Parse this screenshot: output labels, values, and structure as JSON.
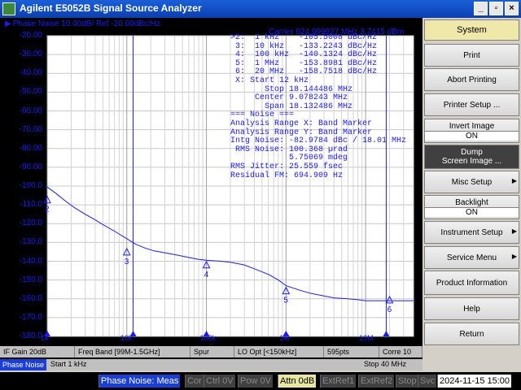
{
  "window": {
    "title": "Agilent E5052B Signal Source Analyzer",
    "btn_min": "_",
    "btn_max": "▫",
    "btn_close": "×"
  },
  "trace": {
    "title": "Phase Noise 10.00dB/ Ref -20.00dBc/Hz",
    "carrier": "Carrier 624.999927 MHz   3.7415 dBm"
  },
  "chart_data": {
    "type": "line",
    "xscale": "log",
    "xlim": [
      1000,
      40000000
    ],
    "ylim": [
      -180,
      -20
    ],
    "y_ticks": [
      "-20.00",
      "-30.00",
      "-40.00",
      "-50.00",
      "-60.00",
      "-70.00",
      "-80.00",
      "-90.00",
      "-100.0",
      "-110.0",
      "-120.0",
      "-130.0",
      "-140.0",
      "-150.0",
      "-160.0",
      "-170.0",
      "-180.0"
    ],
    "x_tick_labels": [
      "1k",
      "10k",
      "100k",
      "1M",
      "10M"
    ],
    "series": [
      {
        "x": [
          1000,
          1300,
          1700,
          2200,
          3000,
          4000,
          5000,
          7000,
          10000,
          13000,
          17000,
          22000,
          30000,
          40000,
          60000,
          80000,
          100000,
          150000,
          200000,
          300000,
          400000,
          600000,
          800000,
          1000000,
          1500000,
          2000000,
          3000000,
          4000000,
          6000000,
          8000000,
          10000000,
          15000000,
          20000000,
          30000000,
          40000000
        ],
        "y": [
          -100.5,
          -104,
          -108,
          -111.5,
          -115,
          -118,
          -120.5,
          -124,
          -128,
          -131,
          -133,
          -134.5,
          -135.5,
          -136.5,
          -138,
          -139,
          -139.5,
          -140,
          -140.5,
          -142,
          -144,
          -147,
          -150,
          -153,
          -155.5,
          -157,
          -158.5,
          -159.5,
          -160,
          -160.5,
          -161,
          -161,
          -161,
          -161,
          -161
        ]
      }
    ],
    "markers": [
      {
        "id": "2",
        "x": 1000,
        "y": -105.5008
      },
      {
        "id": "3",
        "x": 10000,
        "y": -133.2243
      },
      {
        "id": "4",
        "x": 100000,
        "y": -140.1324
      },
      {
        "id": "5",
        "x": 1000000,
        "y": -153.8981
      },
      {
        "id": "6",
        "x": 20000000,
        "y": -158.7518
      }
    ],
    "band_markers_x": [
      12000,
      18144486
    ]
  },
  "annotations": [
    ">2:  1 kHz    -105.5008 dBc/Hz",
    " 3:  10 kHz   -133.2243 dBc/Hz",
    " 4:  100 kHz  -140.1324 dBc/Hz",
    " 5:  1 MHz    -153.8981 dBc/Hz",
    " 6:  20 MHz   -158.7518 dBc/Hz",
    " X: Start 12 kHz",
    "       Stop 18.144486 MHz",
    "     Center 9.078243 MHz",
    "       Span 18.132486 MHz",
    "=== Noise ===",
    "Analysis Range X: Band Marker",
    "Analysis Range Y: Band Marker",
    "Intg Noise: -82.9784 dBc / 18.01 MHz",
    " RMS Noise: 100.368 µrad",
    "            5.75069 mdeg",
    "RMS Jitter: 25.559 fsec",
    "Residual FM: 694.909 Hz"
  ],
  "statusbar1": {
    "if_gain": "IF Gain 20dB",
    "freq_band": "Freq Band [99M-1.5GHz]",
    "spur": "Spur",
    "lo_opt": "LO Opt [<150kHz]",
    "points": "595pts",
    "corr": "Corre 10"
  },
  "statusbar2": {
    "meas_name": "Phase Noise",
    "start": "Start 1 kHz",
    "stop": "Stop 40 MHz"
  },
  "bottombar": {
    "meas": "Phase Noise: Meas",
    "cor": "Cor",
    "ctrl": "Ctrl  0V",
    "pow": "Pow  0V",
    "attn": "Attn 0dB",
    "extref1": "ExtRef1",
    "extref2": "ExtRef2",
    "stop": "Stop",
    "svc": "Svc",
    "clock": "2024-11-15 15:00"
  },
  "softkeys": {
    "header": "System",
    "print": "Print",
    "abort": "Abort Printing",
    "printer_setup": "Printer Setup ...",
    "invert_label": "Invert Image",
    "invert_state": "ON",
    "dump_label": "Dump",
    "dump_sub": "Screen Image ...",
    "misc": "Misc Setup",
    "backlight_label": "Backlight",
    "backlight_state": "ON",
    "instrument": "Instrument Setup",
    "service": "Service Menu",
    "product_info": "Product Information",
    "help": "Help",
    "return": "Return"
  }
}
